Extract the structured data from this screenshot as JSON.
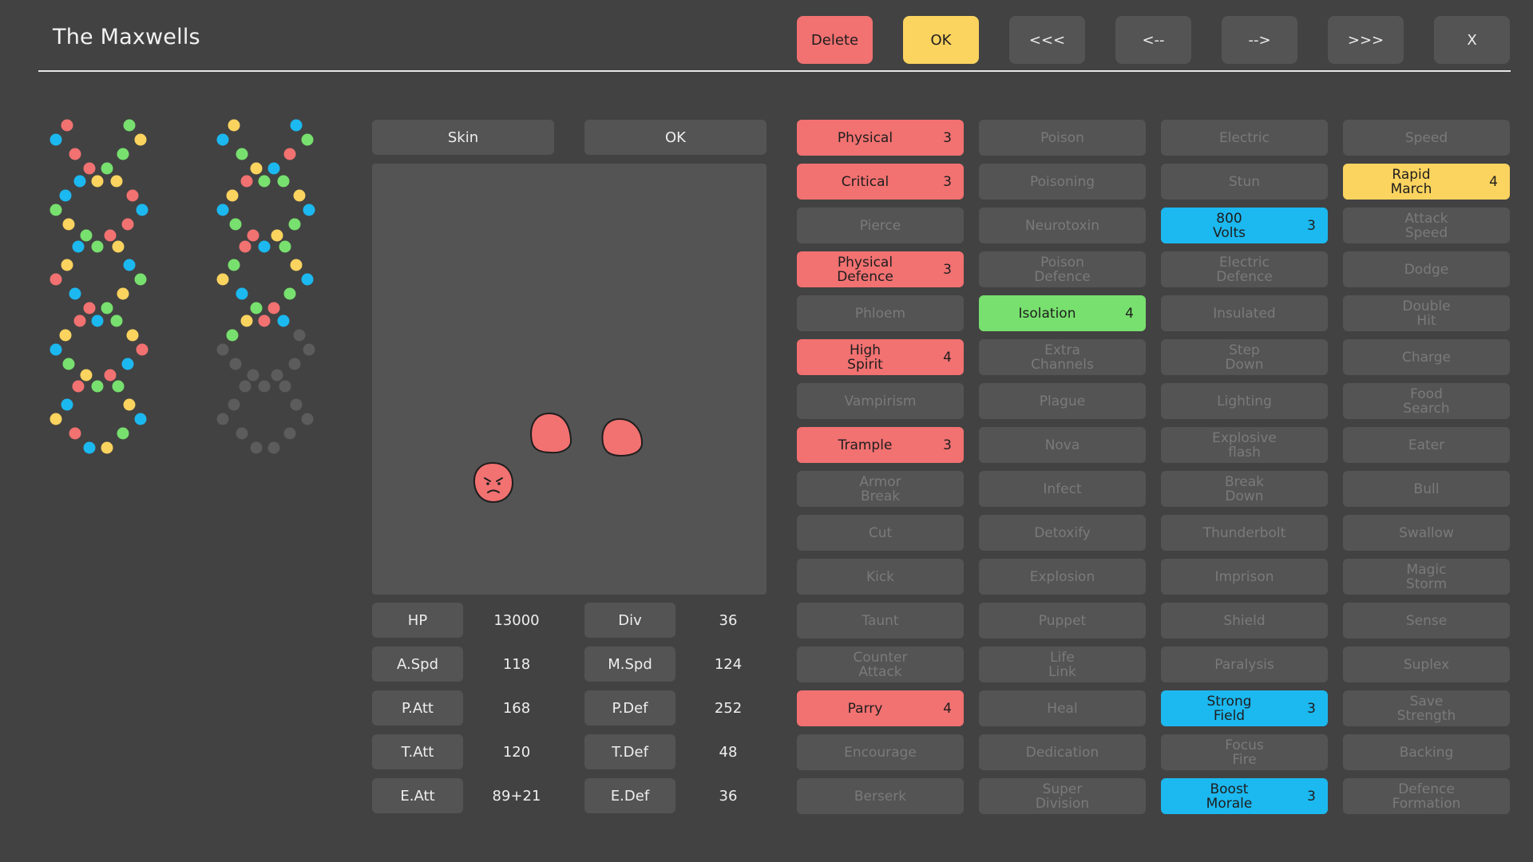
{
  "header": {
    "title": "The Maxwells",
    "buttons": [
      {
        "label": "Delete",
        "color": "red"
      },
      {
        "label": "OK",
        "color": "yellow"
      },
      {
        "label": "<<<"
      },
      {
        "label": "<--"
      },
      {
        "label": "-->"
      },
      {
        "label": ">>>"
      },
      {
        "label": "X"
      }
    ]
  },
  "colors": {
    "background": "#424242",
    "tile": "#545454",
    "red": "#f27171",
    "yellow": "#fbd35f",
    "green": "#78e06e",
    "blue": "#1cb8f0",
    "inactive_text": "#7a7a7a"
  },
  "dna": {
    "strand1": [
      "R",
      "G",
      "B",
      "Y",
      "R",
      "G",
      "R",
      "G",
      "B",
      "Y",
      "Y",
      "B",
      "R",
      "G",
      "B",
      "Y",
      "R",
      "G",
      "R",
      "G",
      "B",
      "Y",
      "Y",
      "B",
      "R",
      "G",
      "B",
      "Y",
      "R",
      "G",
      "R",
      "G",
      "B",
      "Y",
      "Y",
      "B",
      "R",
      "G",
      "B",
      "Y",
      "R",
      "G",
      "R",
      "G",
      "B",
      "Y",
      "Y",
      "B",
      "R",
      "G",
      "B",
      "Y"
    ],
    "strand2": [
      "Y",
      "B",
      "B",
      "G",
      "G",
      "R",
      "Y",
      "B",
      "R",
      "G",
      "G",
      "Y",
      "Y",
      "B",
      "B",
      "G",
      "G",
      "R",
      "Y",
      "B",
      "R",
      "G",
      "G",
      "Y",
      "Y",
      "B",
      "B",
      "G",
      "G",
      "R",
      "Y",
      "B",
      "R",
      "G",
      "G",
      "Y",
      "Y",
      "B",
      "B",
      "G",
      "G",
      "R",
      "Y",
      "B",
      "R",
      "G",
      "G",
      "Y",
      "Y",
      "B",
      "B",
      "G"
    ],
    "strand2_colored_count": 34
  },
  "panel": {
    "skin_label": "Skin",
    "ok_label": "OK"
  },
  "stats": [
    {
      "label": "HP",
      "value": "13000",
      "label2": "Div",
      "value2": "36"
    },
    {
      "label": "A.Spd",
      "value": "118",
      "label2": "M.Spd",
      "value2": "124"
    },
    {
      "label": "P.Att",
      "value": "168",
      "label2": "P.Def",
      "value2": "252"
    },
    {
      "label": "T.Att",
      "value": "120",
      "label2": "T.Def",
      "value2": "48"
    },
    {
      "label": "E.Att",
      "value": "89+21",
      "label2": "E.Def",
      "value2": "36"
    }
  ],
  "traits": [
    [
      {
        "name": "Physical",
        "level": "3",
        "color": "red"
      },
      {
        "name": "Critical",
        "level": "3",
        "color": "red"
      },
      {
        "name": "Pierce"
      },
      {
        "name": "Physical\nDefence",
        "level": "3",
        "color": "red"
      },
      {
        "name": "Phloem"
      },
      {
        "name": "High\nSpirit",
        "level": "4",
        "color": "red"
      },
      {
        "name": "Vampirism"
      },
      {
        "name": "Trample",
        "level": "3",
        "color": "red"
      },
      {
        "name": "Armor\nBreak"
      },
      {
        "name": "Cut"
      },
      {
        "name": "Kick"
      },
      {
        "name": "Taunt"
      },
      {
        "name": "Counter\nAttack"
      },
      {
        "name": "Parry",
        "level": "4",
        "color": "red"
      },
      {
        "name": "Encourage"
      },
      {
        "name": "Berserk"
      }
    ],
    [
      {
        "name": "Poison"
      },
      {
        "name": "Poisoning"
      },
      {
        "name": "Neurotoxin"
      },
      {
        "name": "Poison\nDefence"
      },
      {
        "name": "Isolation",
        "level": "4",
        "color": "green"
      },
      {
        "name": "Extra\nChannels"
      },
      {
        "name": "Plague"
      },
      {
        "name": "Nova"
      },
      {
        "name": "Infect"
      },
      {
        "name": "Detoxify"
      },
      {
        "name": "Explosion"
      },
      {
        "name": "Puppet"
      },
      {
        "name": "Life\nLink"
      },
      {
        "name": "Heal"
      },
      {
        "name": "Dedication"
      },
      {
        "name": "Super\nDivision"
      }
    ],
    [
      {
        "name": "Electric"
      },
      {
        "name": "Stun"
      },
      {
        "name": "800\nVolts",
        "level": "3",
        "color": "blue"
      },
      {
        "name": "Electric\nDefence"
      },
      {
        "name": "Insulated"
      },
      {
        "name": "Step\nDown"
      },
      {
        "name": "Lighting"
      },
      {
        "name": "Explosive\nflash"
      },
      {
        "name": "Break\nDown"
      },
      {
        "name": "Thunderbolt"
      },
      {
        "name": "Imprison"
      },
      {
        "name": "Shield"
      },
      {
        "name": "Paralysis"
      },
      {
        "name": "Strong\nField",
        "level": "3",
        "color": "blue"
      },
      {
        "name": "Focus\nFire"
      },
      {
        "name": "Boost\nMorale",
        "level": "3",
        "color": "blue"
      }
    ],
    [
      {
        "name": "Speed"
      },
      {
        "name": "Rapid\nMarch",
        "level": "4",
        "color": "yellow"
      },
      {
        "name": "Attack\nSpeed"
      },
      {
        "name": "Dodge"
      },
      {
        "name": "Double\nHit"
      },
      {
        "name": "Charge"
      },
      {
        "name": "Food\nSearch"
      },
      {
        "name": "Eater"
      },
      {
        "name": "Bull"
      },
      {
        "name": "Swallow"
      },
      {
        "name": "Magic\nStorm"
      },
      {
        "name": "Sense"
      },
      {
        "name": "Suplex"
      },
      {
        "name": "Save\nStrength"
      },
      {
        "name": "Backing"
      },
      {
        "name": "Defence\nFormation"
      }
    ]
  ]
}
